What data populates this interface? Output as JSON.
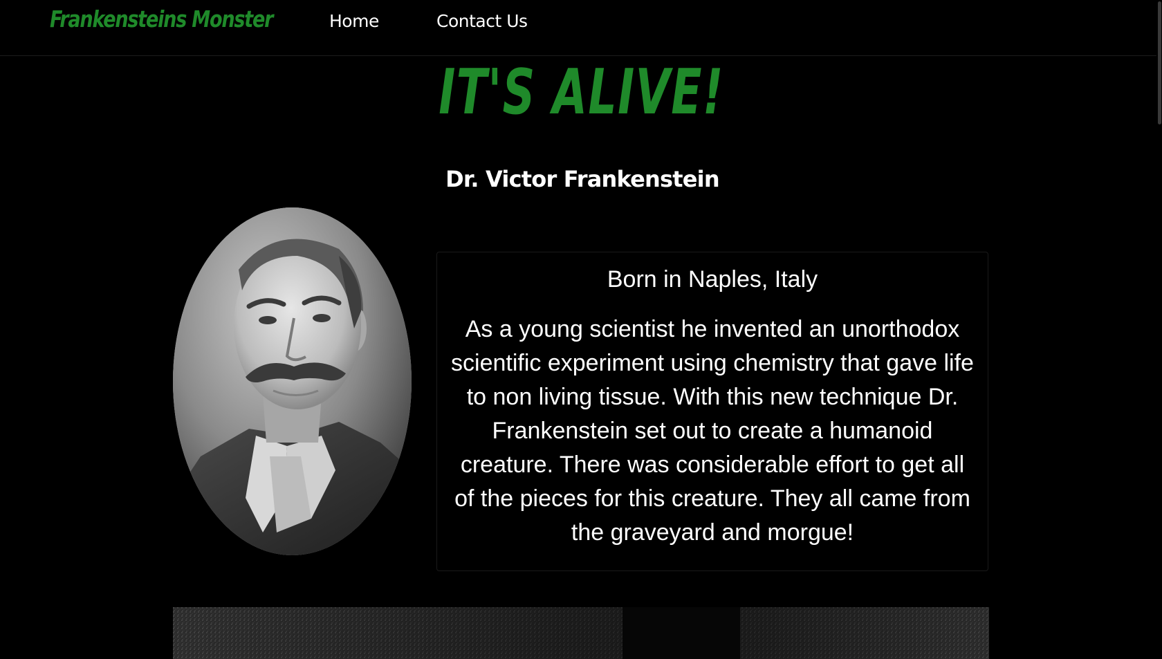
{
  "navbar": {
    "brand": "Frankensteins Monster",
    "links": [
      {
        "label": "Home"
      },
      {
        "label": "Contact Us"
      }
    ]
  },
  "hero": {
    "headline": "IT'S ALIVE!",
    "subhead": "Dr. Victor Frankenstein"
  },
  "bio": {
    "origin": "Born in Naples, Italy",
    "text": "As a young scientist he invented an unorthodox scientific experiment using chemistry that gave life to non living tissue. With this new technique Dr. Frankenstein set out to create a humanoid creature. There was considerable effort to get all of the pieces for this creature. They all came from the graveyard and morgue!"
  },
  "colors": {
    "accent": "#1f8a2a",
    "background": "#000000",
    "text": "#ffffff"
  }
}
